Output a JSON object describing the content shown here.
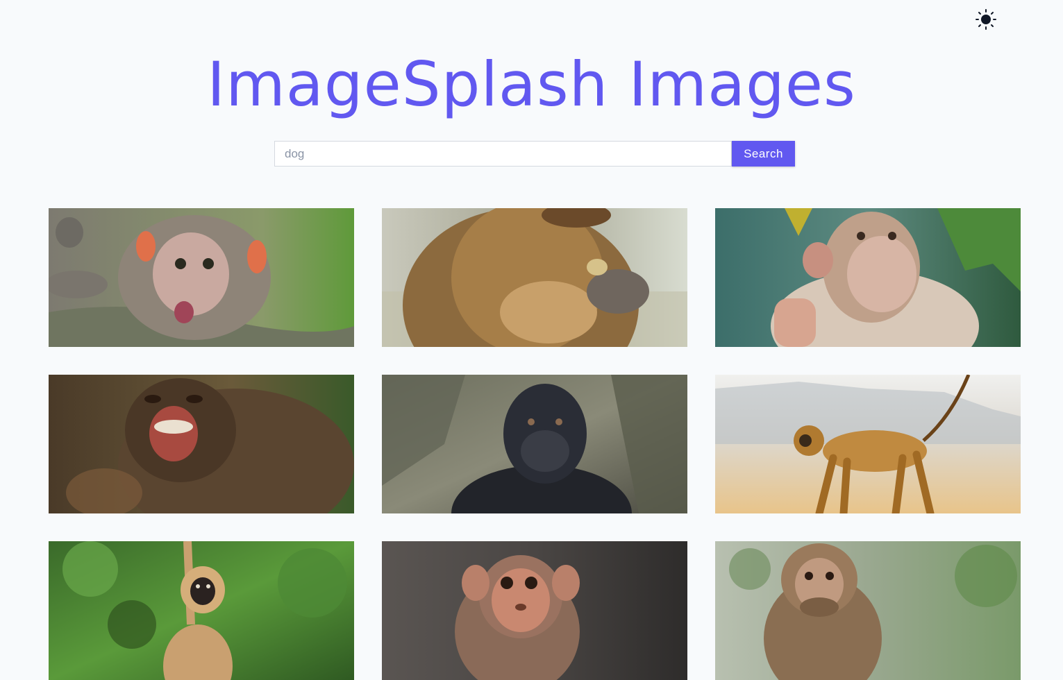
{
  "header": {
    "title": "ImageSplash Images",
    "theme_toggle_icon": "sun-icon"
  },
  "search": {
    "placeholder": "dog",
    "value": "",
    "button_label": "Search"
  },
  "colors": {
    "accent": "#6158f0",
    "background": "#f8fafc"
  },
  "gallery": {
    "images": [
      {
        "subject": "baby macaque with open mouth"
      },
      {
        "subject": "monkey holding food"
      },
      {
        "subject": "macaque waving hand"
      },
      {
        "subject": "screaming chimpanzee"
      },
      {
        "subject": "gorilla against rock"
      },
      {
        "subject": "langur walking"
      },
      {
        "subject": "gibbon in tree"
      },
      {
        "subject": "young macaque portrait"
      },
      {
        "subject": "macaque eating"
      }
    ]
  }
}
